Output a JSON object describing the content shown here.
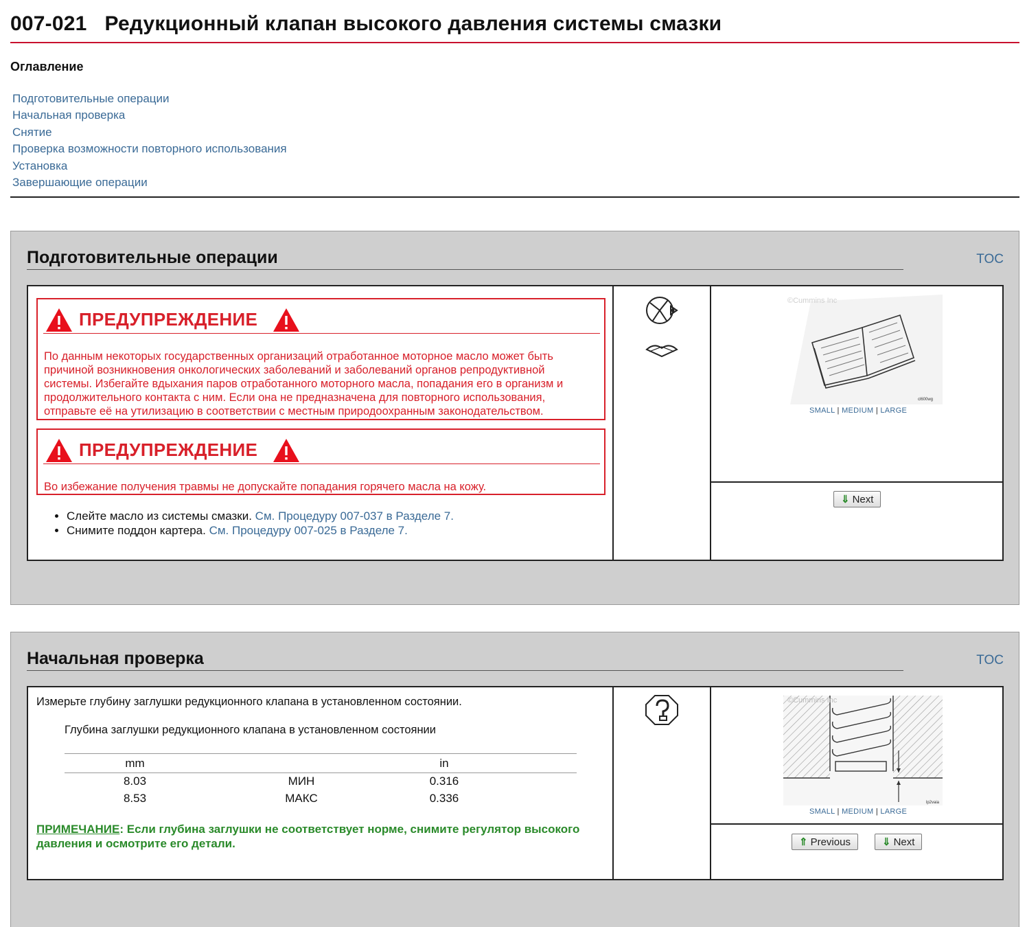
{
  "header": {
    "code": "007-021",
    "title": "Редукционный клапан высокого давления системы смазки"
  },
  "toc": {
    "heading": "Оглавление",
    "items": [
      "Подготовительные операции",
      "Начальная проверка",
      "Снятие",
      "Проверка возможности повторного использования",
      "Установка",
      "Завершающие операции"
    ]
  },
  "prep": {
    "title": "Подготовительные операции",
    "toc_link": "TOC",
    "warning1": {
      "title": "ПРЕДУПРЕЖДЕНИЕ",
      "lines": [
        "По данным некоторых государственных организаций отработанное моторное масло может быть",
        "причиной возникновения онкологических заболеваний и заболеваний органов репродуктивной",
        "системы. Избегайте вдыхания паров отработанного моторного масла, попадания его в организм и",
        "продолжительного контакта с ним. Если она не предназначена для повторного использования,",
        "отправьте её на утилизацию в соответствии с местным природоохранным законодательством."
      ]
    },
    "warning2": {
      "title": "ПРЕДУПРЕЖДЕНИЕ",
      "text": "Во избежание получения травмы не допускайте попадания горячего масла на кожу."
    },
    "steps": [
      {
        "text": "Слейте масло из системы смазки. ",
        "ref": "См. Процедуру 007-037 в Разделе 7."
      },
      {
        "text": "Снимите поддон картера. ",
        "ref": "См. Процедуру 007-025 в Разделе 7."
      }
    ],
    "icons": [
      "gauge-icon",
      "manual-icon"
    ],
    "figure": {
      "copyright": "©Cummins Inc",
      "code": "cl600wg"
    },
    "size_links": {
      "small": "SMALL",
      "medium": "MEDIUM",
      "large": "LARGE",
      "sep": "|"
    },
    "next_label": "Next"
  },
  "check": {
    "title": "Начальная проверка",
    "toc_link": "TOC",
    "instruction": "Измерьте глубину заглушки редукционного клапана в установленном состоянии.",
    "spec_title": "Глубина заглушки редукционного клапана в установленном состоянии",
    "table": {
      "headers": [
        "mm",
        "",
        "in"
      ],
      "rows": [
        [
          "8.03",
          "МИН",
          "0.316"
        ],
        [
          "8.53",
          "МАКС",
          "0.336"
        ]
      ]
    },
    "note_label": "ПРИМЕЧАНИЕ",
    "note_text": ": Если глубина заглушки не соответствует норме, снимите регулятор высокого давления и осмотрите его детали.",
    "icons": [
      "inspect-icon"
    ],
    "figure": {
      "copyright": "©Cummins Inc",
      "code": "lp2vaia"
    },
    "size_links": {
      "small": "SMALL",
      "medium": "MEDIUM",
      "large": "LARGE",
      "sep": "|"
    },
    "previous_label": "Previous",
    "next_label": "Next"
  },
  "colors": {
    "title_rule": "#c8102e",
    "link": "#3a6a96",
    "warning": "#d8202a",
    "note": "#2a8a2a",
    "section_bg": "#cfcfcf"
  }
}
